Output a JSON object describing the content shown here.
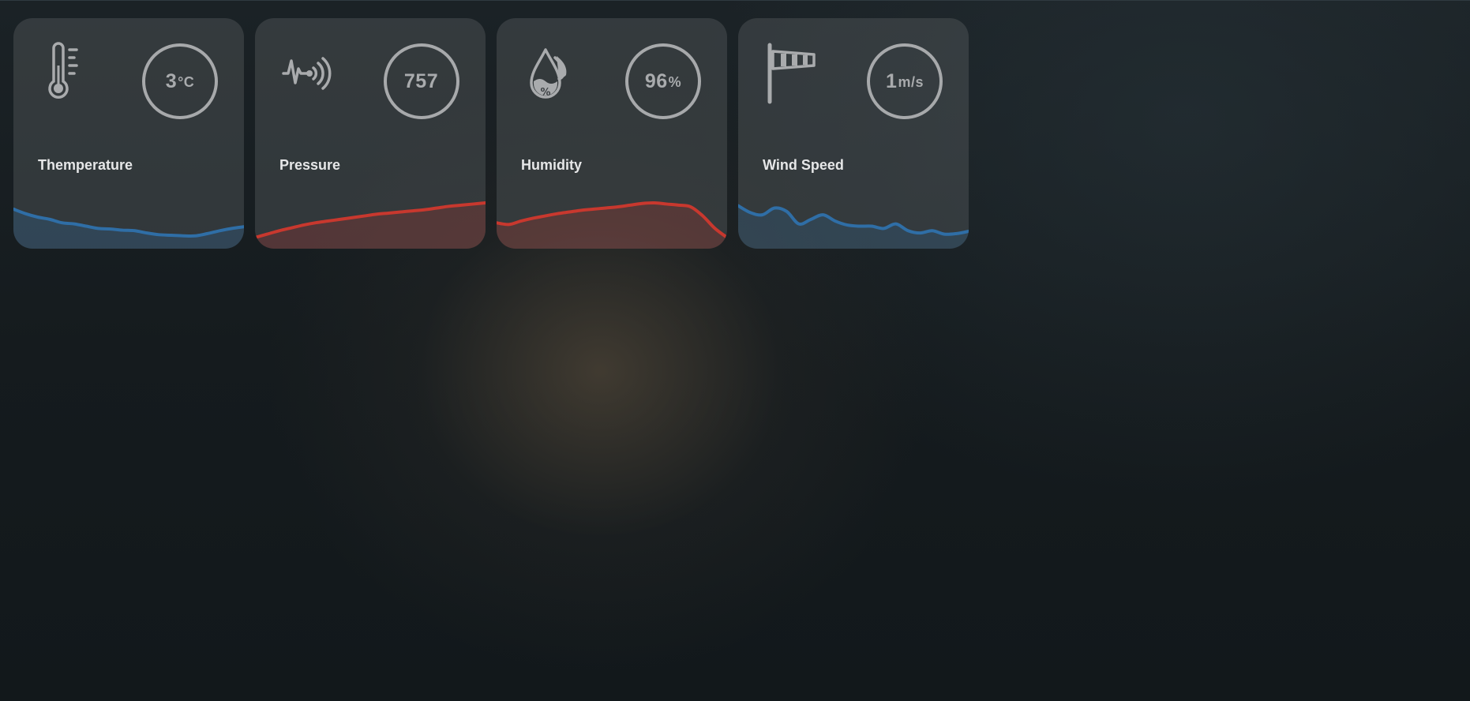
{
  "cards": [
    {
      "label": "Themperature",
      "value": "3",
      "unit": "°C",
      "icon": "thermometer-icon",
      "line_color": "#2f6ea6",
      "fill_color": "rgba(47,110,166,0.25)",
      "trend": [
        64,
        56,
        50,
        46,
        40,
        38,
        34,
        30,
        29,
        27,
        26,
        22,
        19,
        18,
        17,
        17,
        21,
        26,
        30,
        33
      ]
    },
    {
      "label": "Pressure",
      "value": "757",
      "unit": "",
      "icon": "pressure-signal-icon",
      "line_color": "#c8382e",
      "fill_color": "rgba(200,56,46,0.22)",
      "trend": [
        14,
        20,
        26,
        31,
        36,
        40,
        43,
        46,
        49,
        52,
        55,
        57,
        59,
        61,
        63,
        66,
        69,
        71,
        73,
        75
      ]
    },
    {
      "label": "Humidity",
      "value": "96",
      "unit": "%",
      "icon": "humidity-drop-icon",
      "line_color": "#c8382e",
      "fill_color": "rgba(200,56,46,0.22)",
      "trend": [
        40,
        37,
        43,
        48,
        52,
        56,
        59,
        62,
        64,
        66,
        68,
        71,
        74,
        75,
        73,
        71,
        68,
        52,
        30,
        14
      ]
    },
    {
      "label": "Wind Speed",
      "value": "1",
      "unit": "m/s",
      "icon": "windsock-icon",
      "line_color": "#2f6ea6",
      "fill_color": "rgba(47,110,166,0.22)",
      "trend": [
        70,
        58,
        54,
        66,
        60,
        38,
        46,
        54,
        43,
        36,
        34,
        34,
        30,
        38,
        26,
        22,
        26,
        20,
        21,
        25
      ]
    }
  ]
}
